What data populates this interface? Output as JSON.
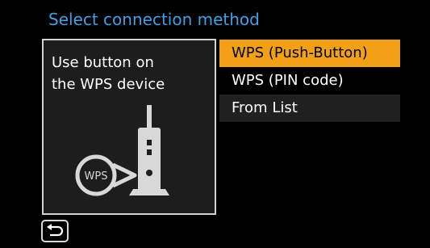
{
  "header": {
    "title": "Select connection method"
  },
  "preview": {
    "line1": "Use button on",
    "line2": "the WPS device",
    "badge": "WPS",
    "icons": [
      "wps-router-icon"
    ]
  },
  "menu": {
    "items": [
      {
        "label": "WPS (Push-Button)",
        "state": "selected"
      },
      {
        "label": "WPS (PIN code)",
        "state": "normal"
      },
      {
        "label": "From List",
        "state": "normal"
      }
    ]
  },
  "footer": {
    "back_icon": "return-arrow-icon"
  },
  "colors": {
    "title": "#3fa0e6",
    "selected_bg": "#f2a117",
    "text": "#ffffff",
    "background": "#000000"
  }
}
